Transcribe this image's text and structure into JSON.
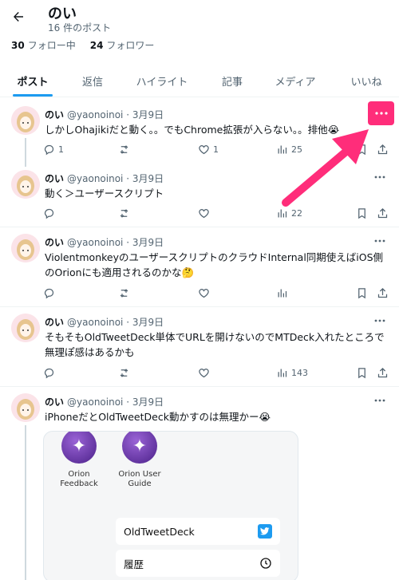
{
  "header": {
    "name": "のい",
    "post_count": "16 件のポスト",
    "following_count": "30",
    "following_label": "フォロー中",
    "followers_count": "24",
    "followers_label": "フォロワー"
  },
  "tabs": [
    "ポスト",
    "返信",
    "ハイライト",
    "記事",
    "メディア",
    "いいね"
  ],
  "posts": [
    {
      "name": "のい",
      "handle": "@yaonoinoi",
      "date": "3月9日",
      "text": "しかしOhajikiだと動く。。でもChrome拡張が入らない。。排他😭",
      "replies": "1",
      "retweets": "",
      "likes": "1",
      "views": "25"
    },
    {
      "name": "のい",
      "handle": "@yaonoinoi",
      "date": "3月9日",
      "text": "動く＞ユーザースクリプト",
      "replies": "",
      "retweets": "",
      "likes": "",
      "views": "22"
    },
    {
      "name": "のい",
      "handle": "@yaonoinoi",
      "date": "3月9日",
      "text": "ViolentmonkeyのユーザースクリプトのクラウドInternal同期使えばiOS側のOrionにも適用されるのかな🤔",
      "replies": "",
      "retweets": "",
      "likes": "",
      "views": ""
    },
    {
      "name": "のい",
      "handle": "@yaonoinoi",
      "date": "3月9日",
      "text": "そもそもOldTweetDeck単体でURLを開けないのでMTDeck入れたところで無理ぽ感はあるかも",
      "replies": "",
      "retweets": "",
      "likes": "",
      "views": "143"
    },
    {
      "name": "のい",
      "handle": "@yaonoinoi",
      "date": "3月9日",
      "text": "iPhoneだとOldTweetDeck動かすのは無理かー😭"
    }
  ],
  "embed": {
    "app1_label": "Orion\nFeedback",
    "app2_label": "Orion User\nGuide",
    "menu1": "OldTweetDeck",
    "menu2": "履歴"
  },
  "colors": {
    "accent": "#1d9bf0",
    "highlight": "#ff2d7a",
    "secondary_text": "#536471"
  }
}
